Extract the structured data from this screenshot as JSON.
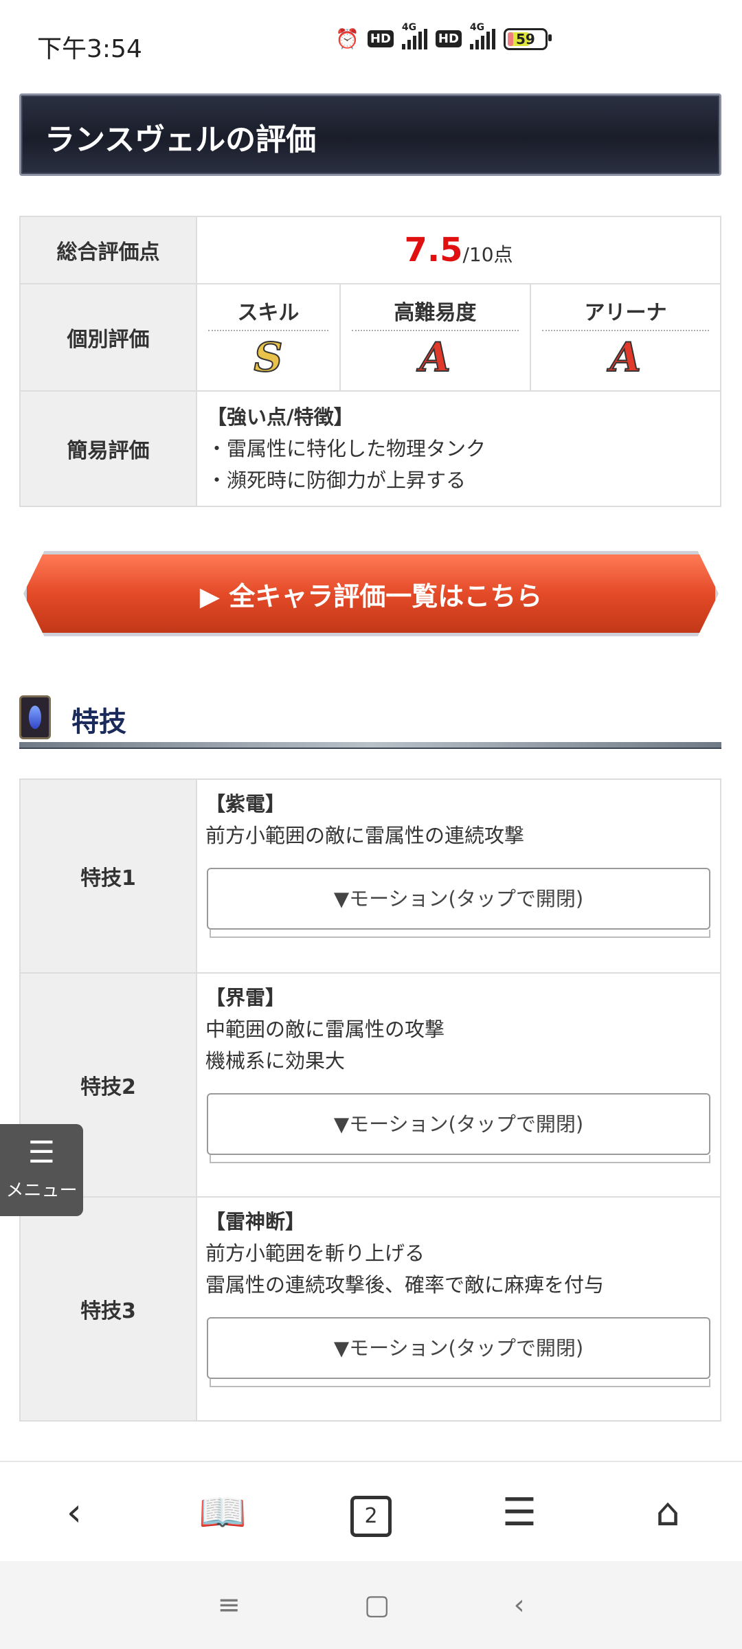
{
  "status_bar": {
    "time": "下午3:54",
    "net1": "4G",
    "net2": "4G",
    "battery": "59",
    "hd": "HD"
  },
  "banner": {
    "title": "ランスヴェルの評価"
  },
  "rating": {
    "overall_label": "総合評価点",
    "overall_score": "7.5",
    "overall_suffix": "/10点",
    "individual_label": "個別評価",
    "categories": [
      {
        "name": "スキル",
        "grade": "S"
      },
      {
        "name": "高難易度",
        "grade": "A"
      },
      {
        "name": "アリーナ",
        "grade": "A"
      }
    ],
    "simple_label": "簡易評価",
    "simple_heading": "【強い点/特徴】",
    "simple_points": [
      "・雷属性に特化した物理タンク",
      "・瀕死時に防御力が上昇する"
    ]
  },
  "cta": {
    "label": "▶ 全キャラ評価一覧はこちら"
  },
  "section": {
    "title": "特技",
    "icon": "gem-icon"
  },
  "skills": [
    {
      "label": "特技1",
      "name": "【紫電】",
      "lines": [
        "前方小範囲の敵に雷属性の連続攻撃"
      ],
      "motion": "▼モーション(タップで開閉)"
    },
    {
      "label": "特技2",
      "name": "【界雷】",
      "lines": [
        "中範囲の敵に雷属性の攻撃",
        "機械系に効果大"
      ],
      "motion": "▼モーション(タップで開閉)"
    },
    {
      "label": "特技3",
      "name": "【雷神断】",
      "lines": [
        "前方小範囲を斬り上げる",
        "雷属性の連続攻撃後、確率で敵に麻痺を付与"
      ],
      "motion": "▼モーション(タップで開閉)"
    }
  ],
  "menu": {
    "label": "メニュー"
  },
  "browser": {
    "tab_count": "2"
  }
}
